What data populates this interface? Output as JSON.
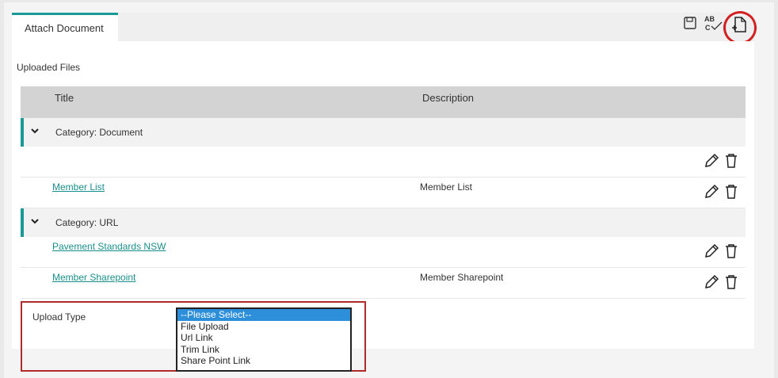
{
  "tabs": [
    {
      "label": "Attach Document",
      "active": true
    }
  ],
  "toolbar": {
    "save_icon": "save-icon",
    "spellcheck_text": "AB C",
    "new_doc_icon": "new-document-icon"
  },
  "section": {
    "title": "Uploaded Files"
  },
  "table": {
    "columns": [
      "Title",
      "Description"
    ],
    "groups": [
      {
        "category": "Category: Document",
        "rows": [
          {
            "title": "",
            "description": ""
          },
          {
            "title": "Member List",
            "description": "Member List"
          }
        ]
      },
      {
        "category": "Category: URL",
        "rows": [
          {
            "title": "Pavement Standards NSW",
            "description": ""
          },
          {
            "title": "Member Sharepoint",
            "description": "Member Sharepoint"
          }
        ]
      }
    ]
  },
  "upload": {
    "label": "Upload Type",
    "options": [
      "--Please Select--",
      "File Upload",
      "Url Link",
      "Trim Link",
      "Share Point Link"
    ],
    "selected_index": 0
  },
  "colors": {
    "accent": "#1a9a96",
    "link": "#1a8f8b",
    "highlight": "#b02a2a",
    "selected": "#2d8fd9"
  }
}
